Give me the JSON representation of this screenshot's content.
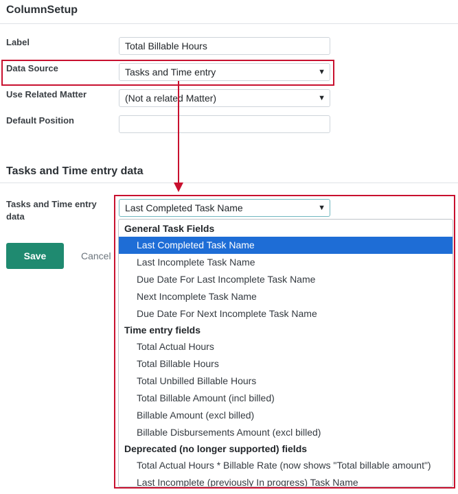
{
  "page": {
    "title": "ColumnSetup"
  },
  "form": {
    "label": {
      "label": "Label",
      "value": "Total Billable Hours"
    },
    "data_source": {
      "label": "Data Source",
      "value": "Tasks and Time entry"
    },
    "related_matter": {
      "label": "Use Related Matter",
      "value": "(Not a related Matter)"
    },
    "default_position": {
      "label": "Default Position",
      "value": ""
    }
  },
  "section": {
    "title": "Tasks and Time entry data",
    "field_label_line1": "Tasks and Time entry",
    "field_label_line2": "data",
    "value": "Last Completed Task Name"
  },
  "actions": {
    "save": "Save",
    "cancel": "Cancel"
  },
  "dropdown": {
    "groups": [
      {
        "label": "General Task Fields",
        "options": [
          "Last Completed Task Name",
          "Last Incomplete Task Name",
          "Due Date For Last Incomplete Task Name",
          "Next Incomplete Task Name",
          "Due Date For Next Incomplete Task Name"
        ]
      },
      {
        "label": "Time entry fields",
        "options": [
          "Total Actual Hours",
          "Total Billable Hours",
          "Total Unbilled Billable Hours",
          "Total Billable Amount (incl billed)",
          "Billable Amount (excl billed)",
          "Billable Disbursements Amount (excl billed)"
        ]
      },
      {
        "label": "Deprecated (no longer supported) fields",
        "options": [
          "Total Actual Hours * Billable Rate (now shows \"Total billable amount\")",
          "Last Incomplete (previously In progress) Task Name"
        ]
      }
    ],
    "selected": "Last Completed Task Name"
  },
  "colors": {
    "accent": "#1f8a70",
    "highlight": "#c8102e",
    "selection": "#1e6dd6"
  },
  "icons": {
    "select_arrow": "chevron-down-icon"
  }
}
